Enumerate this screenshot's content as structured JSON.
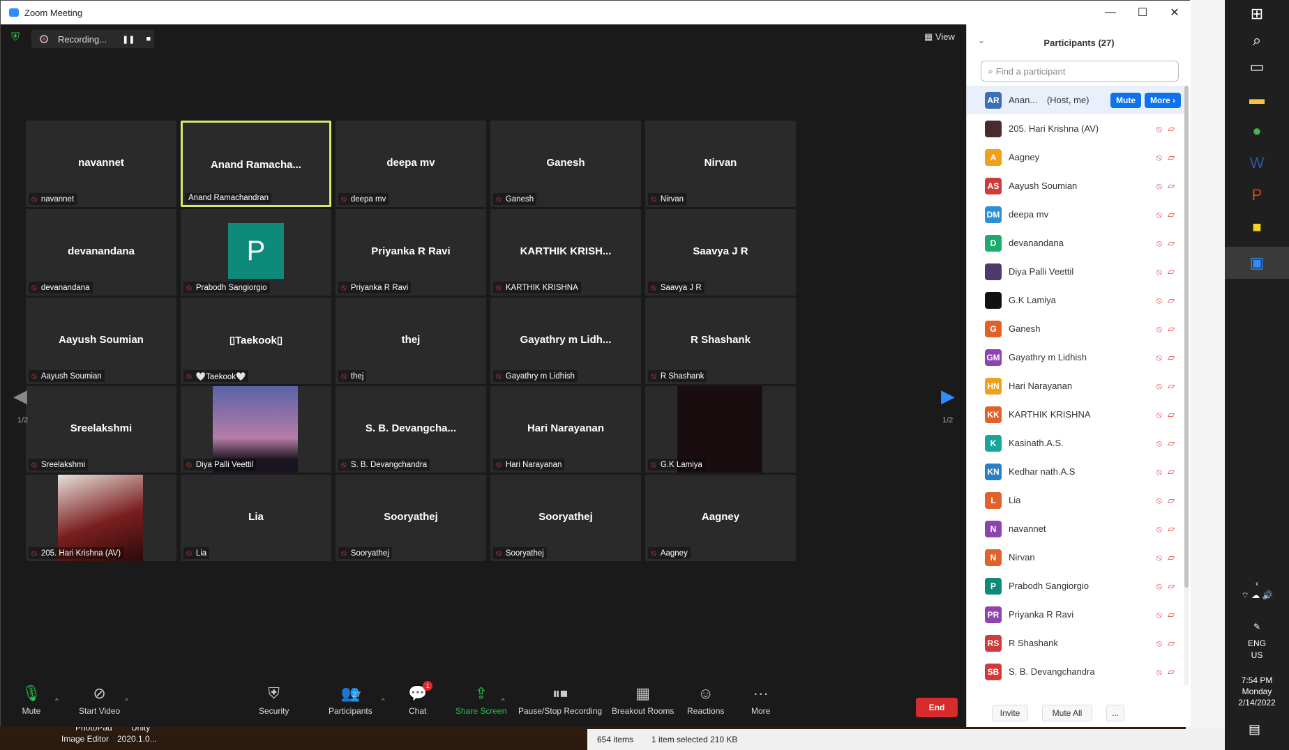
{
  "window": {
    "title": "Zoom Meeting",
    "minimize": "—",
    "maximize": "☐",
    "close": "✕"
  },
  "meeting": {
    "recording_label": "Recording...",
    "view_label": "View",
    "page_indicator": "1/2"
  },
  "tiles": [
    {
      "big": "navannet",
      "caption": "navannet",
      "active": false,
      "kind": "name"
    },
    {
      "big": "Anand  Ramacha...",
      "caption": "Anand Ramachandran",
      "active": true,
      "kind": "name"
    },
    {
      "big": "deepa mv",
      "caption": "deepa mv",
      "active": false,
      "kind": "name"
    },
    {
      "big": "Ganesh",
      "caption": "Ganesh",
      "active": false,
      "kind": "name"
    },
    {
      "big": "Nirvan",
      "caption": "Nirvan",
      "active": false,
      "kind": "name"
    },
    {
      "big": "devanandana",
      "caption": "devanandana",
      "active": false,
      "kind": "name"
    },
    {
      "big": "P",
      "caption": "Prabodh Sangiorgio",
      "active": false,
      "kind": "avatar"
    },
    {
      "big": "Priyanka R Ravi",
      "caption": "Priyanka R Ravi",
      "active": false,
      "kind": "name"
    },
    {
      "big": "KARTHIK  KRISH...",
      "caption": "KARTHIK KRISHNA",
      "active": false,
      "kind": "name"
    },
    {
      "big": "Saavya J R",
      "caption": "Saavya J R",
      "active": false,
      "kind": "name"
    },
    {
      "big": "Aayush Soumian",
      "caption": "Aayush Soumian",
      "active": false,
      "kind": "name"
    },
    {
      "big": "▯Taekook▯",
      "caption": "🤍Taekook🤍",
      "active": false,
      "kind": "name"
    },
    {
      "big": "thej",
      "caption": "thej",
      "active": false,
      "kind": "name"
    },
    {
      "big": "Gayathry  m  Lidh...",
      "caption": "Gayathry m Lidhish",
      "active": false,
      "kind": "name"
    },
    {
      "big": "R Shashank",
      "caption": "R Shashank",
      "active": false,
      "kind": "name"
    },
    {
      "big": "Sreelakshmi",
      "caption": "Sreelakshmi",
      "active": false,
      "kind": "name"
    },
    {
      "big": "",
      "caption": "Diya Palli Veettil",
      "active": false,
      "kind": "silhouette"
    },
    {
      "big": "S. B. Devangcha...",
      "caption": "S. B. Devangchandra",
      "active": false,
      "kind": "name"
    },
    {
      "big": "Hari Narayanan",
      "caption": "Hari Narayanan",
      "active": false,
      "kind": "name"
    },
    {
      "big": "",
      "caption": "G.K Lamiya",
      "active": false,
      "kind": "dark"
    },
    {
      "big": "",
      "caption": "205. Hari Krishna (AV)",
      "active": false,
      "kind": "anime"
    },
    {
      "big": "Lia",
      "caption": "Lia",
      "active": false,
      "kind": "name"
    },
    {
      "big": "Sooryathej",
      "caption": "Sooryathej",
      "active": false,
      "kind": "name"
    },
    {
      "big": "Sooryathej",
      "caption": "Sooryathej",
      "active": false,
      "kind": "name"
    },
    {
      "big": "Aagney",
      "caption": "Aagney",
      "active": false,
      "kind": "name"
    }
  ],
  "toolbar": {
    "mute": "Mute",
    "start_video": "Start Video",
    "security": "Security",
    "participants": "Participants",
    "participants_count": "27",
    "chat": "Chat",
    "chat_badge": "1",
    "share_screen": "Share Screen",
    "pause_stop_recording": "Pause/Stop Recording",
    "breakout_rooms": "Breakout Rooms",
    "reactions": "Reactions",
    "more": "More",
    "end": "End"
  },
  "panel": {
    "title": "Participants (27)",
    "search_placeholder": "Find a participant",
    "host_row": {
      "initials": "AR",
      "name": "Anan...",
      "role": "(Host, me)",
      "mute": "Mute",
      "more": "More ›",
      "color": "#3b6fb6"
    },
    "participants": [
      {
        "initials": "",
        "name": "205. Hari Krishna (AV)",
        "color": "#4a2a2a"
      },
      {
        "initials": "A",
        "name": "Aagney",
        "color": "#f0a019"
      },
      {
        "initials": "AS",
        "name": "Aayush Soumian",
        "color": "#d03a3a"
      },
      {
        "initials": "DM",
        "name": "deepa mv",
        "color": "#2a8fd6"
      },
      {
        "initials": "D",
        "name": "devanandana",
        "color": "#1eaa6a"
      },
      {
        "initials": "",
        "name": "Diya Palli Veettil",
        "color": "#4b3a6a"
      },
      {
        "initials": "",
        "name": "G.K Lamiya",
        "color": "#111111"
      },
      {
        "initials": "G",
        "name": "Ganesh",
        "color": "#e0622a"
      },
      {
        "initials": "GM",
        "name": "Gayathry m Lidhish",
        "color": "#8e44ad"
      },
      {
        "initials": "HN",
        "name": "Hari Narayanan",
        "color": "#f0a019"
      },
      {
        "initials": "KK",
        "name": "KARTHIK KRISHNA",
        "color": "#e0622a"
      },
      {
        "initials": "K",
        "name": "Kasinath.A.S.",
        "color": "#1aa59a"
      },
      {
        "initials": "KN",
        "name": "Kedhar nath.A.S",
        "color": "#2a7fc2"
      },
      {
        "initials": "L",
        "name": "Lia",
        "color": "#e0622a"
      },
      {
        "initials": "N",
        "name": "navannet",
        "color": "#8e44ad"
      },
      {
        "initials": "N",
        "name": "Nirvan",
        "color": "#e0622a"
      },
      {
        "initials": "P",
        "name": "Prabodh Sangiorgio",
        "color": "#0e8a7b"
      },
      {
        "initials": "PR",
        "name": "Priyanka R Ravi",
        "color": "#8e44ad"
      },
      {
        "initials": "RS",
        "name": "R Shashank",
        "color": "#d03a3a"
      },
      {
        "initials": "SB",
        "name": "S. B. Devangchandra",
        "color": "#d03a3a"
      }
    ],
    "invite": "Invite",
    "mute_all": "Mute All",
    "more_dots": "..."
  },
  "desktop": {
    "status_items": "654 items",
    "status_selected": "1 item selected  210 KB",
    "behind_label_1": "PhotoPad",
    "behind_label_2": "Image Editor",
    "behind_label_3": "Unity",
    "behind_label_4": "2020.1.0...",
    "tray_lang": "ENG",
    "tray_region": "US",
    "clock_time": "7:54 PM",
    "clock_day": "Monday",
    "clock_date": "2/14/2022"
  }
}
